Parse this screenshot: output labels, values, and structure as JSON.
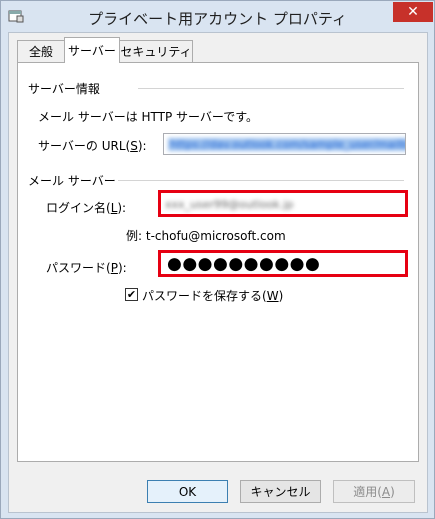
{
  "window": {
    "title": "プライベート用アカウント プロパティ",
    "close_symbol": "✕",
    "icon": "account-properties-icon"
  },
  "tabs": [
    {
      "label": "全般",
      "active": false
    },
    {
      "label": "サーバー",
      "active": true
    },
    {
      "label": "セキュリティ",
      "active": false
    }
  ],
  "server_info": {
    "section_title": "サーバー情報",
    "description": "メール サーバーは HTTP サーバーです。",
    "url_label_prefix": "サーバーの URL(",
    "url_label_key": "S",
    "url_label_suffix": "):",
    "url_value": "https://dav.outlook.com/sample_user/mailbox/default.aspx"
  },
  "mail_server": {
    "section_title": "メール サーバー",
    "login_label_prefix": "ログイン名(",
    "login_label_key": "L",
    "login_label_suffix": "):",
    "login_value": "xxx_user99@outlook.jp",
    "example_text": "例: t-chofu@microsoft.com",
    "password_label_prefix": "パスワード(",
    "password_label_key": "P",
    "password_label_suffix": "):",
    "password_dots": "●●●●●●●●●●",
    "save_password_prefix": "パスワードを保存する(",
    "save_password_key": "W",
    "save_password_suffix": ")",
    "save_password_checked": true,
    "check_mark": "✔"
  },
  "buttons": {
    "ok": "OK",
    "cancel": "キャンセル",
    "apply_prefix": "適用(",
    "apply_key": "A",
    "apply_suffix": ")"
  },
  "colors": {
    "highlight": "#e60012",
    "close_button": "#c7312a",
    "titlebar": "#d9e4f1"
  }
}
